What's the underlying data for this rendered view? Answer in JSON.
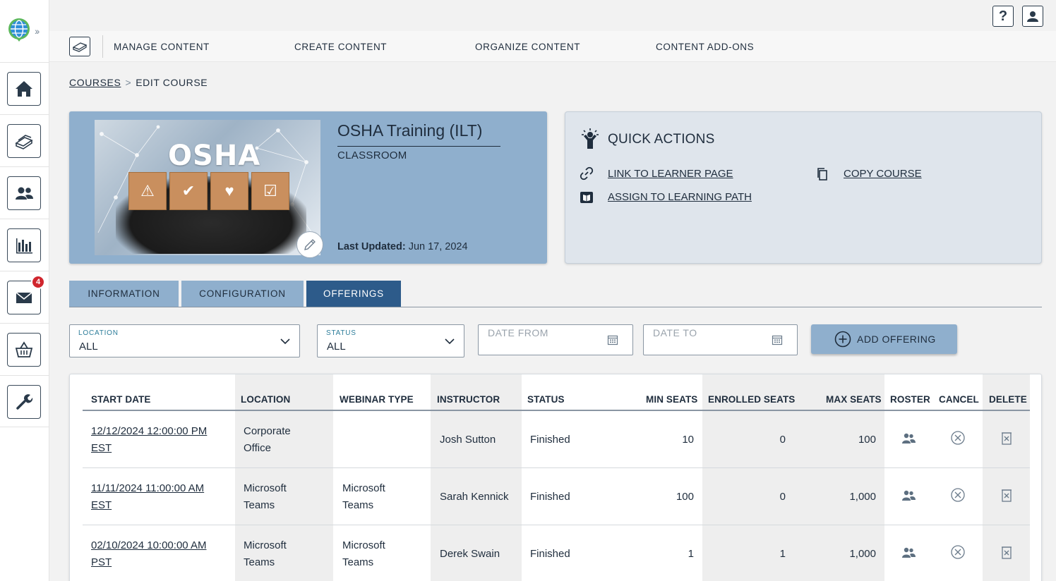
{
  "sidebar": {
    "badge_count": "4",
    "items": [
      {
        "name": "home-icon"
      },
      {
        "name": "content-icon"
      },
      {
        "name": "users-icon"
      },
      {
        "name": "reports-icon"
      },
      {
        "name": "messages-icon"
      },
      {
        "name": "store-icon"
      },
      {
        "name": "admin-tools-icon"
      }
    ]
  },
  "topbar": {
    "help_label": "?"
  },
  "nav": {
    "items": [
      "MANAGE CONTENT",
      "CREATE CONTENT",
      "ORGANIZE CONTENT",
      "CONTENT ADD-ONS"
    ]
  },
  "breadcrumb": {
    "parent": "COURSES",
    "separator": ">",
    "current": "EDIT COURSE"
  },
  "course": {
    "image_text": "OSHA",
    "title": "OSHA Training (ILT)",
    "type": "CLASSROOM",
    "last_updated_label": "Last Updated:",
    "last_updated_value": "Jun 17, 2024"
  },
  "quick_actions": {
    "title": "QUICK ACTIONS",
    "link_to_learner": "LINK TO LEARNER PAGE",
    "copy_course": "COPY COURSE",
    "assign_path": "ASSIGN TO LEARNING PATH"
  },
  "tabs": [
    "INFORMATION",
    "CONFIGURATION",
    "OFFERINGS"
  ],
  "active_tab": "OFFERINGS",
  "filters": {
    "location_label": "LOCATION",
    "location_value": "ALL",
    "status_label": "STATUS",
    "status_value": "ALL",
    "date_from_placeholder": "DATE FROM",
    "date_to_placeholder": "DATE TO",
    "add_offering": "ADD OFFERING"
  },
  "table": {
    "headers": [
      "START DATE",
      "LOCATION",
      "WEBINAR TYPE",
      "INSTRUCTOR",
      "STATUS",
      "MIN SEATS",
      "ENROLLED SEATS",
      "MAX SEATS",
      "ROSTER",
      "CANCEL",
      "DELETE"
    ],
    "rows": [
      {
        "start_line1": "12/12/2024 12:00:00 PM",
        "start_line2": "EST",
        "location_line1": "Corporate",
        "location_line2": "Office",
        "webinar_line1": "",
        "webinar_line2": "",
        "instructor": "Josh Sutton",
        "status": "Finished",
        "min_seats": "10",
        "enrolled_seats": "0",
        "max_seats": "100"
      },
      {
        "start_line1": "11/11/2024 11:00:00 AM",
        "start_line2": "EST",
        "location_line1": "Microsoft",
        "location_line2": "Teams",
        "webinar_line1": "Microsoft",
        "webinar_line2": "Teams",
        "instructor": "Sarah Kennick",
        "status": "Finished",
        "min_seats": "100",
        "enrolled_seats": "0",
        "max_seats": "1,000"
      },
      {
        "start_line1": "02/10/2024 10:00:00 AM",
        "start_line2": "PST",
        "location_line1": "Microsoft",
        "location_line2": "Teams",
        "webinar_line1": "Microsoft",
        "webinar_line2": "Teams",
        "instructor": "Derek Swain",
        "status": "Finished",
        "min_seats": "1",
        "enrolled_seats": "1",
        "max_seats": "1,000"
      }
    ]
  },
  "colors": {
    "accent_blue": "#8fafcd",
    "active_tab": "#2d5b8a",
    "badge_red": "#d0262e",
    "text_dark": "#1f2d3d"
  }
}
